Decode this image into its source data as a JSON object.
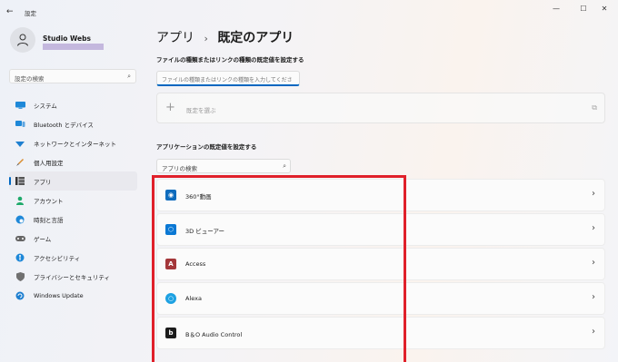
{
  "window": {
    "title": "設定",
    "back_icon": "back-arrow-icon",
    "minimize": "—",
    "maximize": "☐",
    "close": "✕"
  },
  "profile": {
    "name": "Studio Webs"
  },
  "sidebar": {
    "search_placeholder": "設定の検索",
    "items": [
      {
        "label": "システム",
        "icon": "monitor-icon",
        "active": false
      },
      {
        "label": "Bluetooth とデバイス",
        "icon": "bluetooth-icon",
        "active": false
      },
      {
        "label": "ネットワークとインターネット",
        "icon": "wifi-icon",
        "active": false
      },
      {
        "label": "個人用設定",
        "icon": "brush-icon",
        "active": false
      },
      {
        "label": "アプリ",
        "icon": "apps-icon",
        "active": true
      },
      {
        "label": "アカウント",
        "icon": "person-icon",
        "active": false
      },
      {
        "label": "時刻と言語",
        "icon": "globe-clock-icon",
        "active": false
      },
      {
        "label": "ゲーム",
        "icon": "gamepad-icon",
        "active": false
      },
      {
        "label": "アクセシビリティ",
        "icon": "accessibility-icon",
        "active": false
      },
      {
        "label": "プライバシーとセキュリティ",
        "icon": "shield-icon",
        "active": false
      },
      {
        "label": "Windows Update",
        "icon": "update-icon",
        "active": false
      }
    ]
  },
  "main": {
    "breadcrumb": {
      "parent": "アプリ",
      "separator": "›",
      "current": "既定のアプリ"
    },
    "file_section_label": "ファイルの種類またはリンクの種類の既定値を設定する",
    "file_input_placeholder": "ファイルの種類またはリンクの種類を入力してくださ",
    "choose_default_label": "既定を選ぶ",
    "app_section_label": "アプリケーションの既定値を設定する",
    "app_search_placeholder": "アプリの検索",
    "apps": [
      {
        "name": "360°動画",
        "icon": "360-video-icon",
        "color": "#0f6cbd",
        "glyph": "◉"
      },
      {
        "name": "3D ビューアー",
        "icon": "3d-viewer-icon",
        "color": "#0a78d4",
        "glyph": "⬡"
      },
      {
        "name": "Access",
        "icon": "access-icon",
        "color": "#a4373a",
        "glyph": "A"
      },
      {
        "name": "Alexa",
        "icon": "alexa-icon",
        "color": "#1da1e2",
        "glyph": "○"
      },
      {
        "name": "B＆O Audio Control",
        "icon": "bo-audio-icon",
        "color": "#1b1b1b",
        "glyph": "b"
      }
    ]
  },
  "colors": {
    "accent": "#0067c0",
    "highlight": "#e0202a"
  }
}
